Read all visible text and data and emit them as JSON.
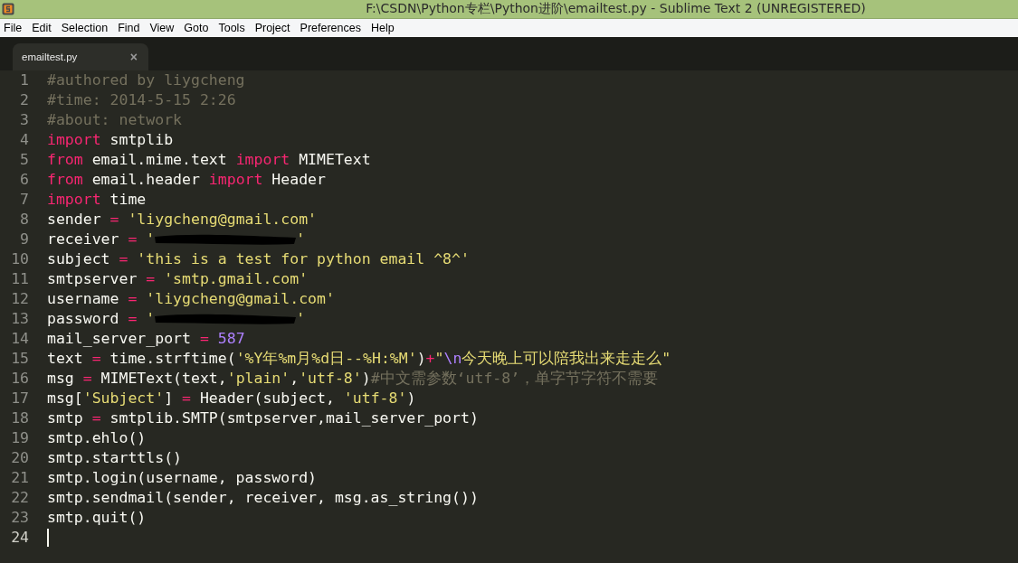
{
  "window": {
    "title": "F:\\CSDN\\Python专栏\\Python进阶\\emailtest.py - Sublime Text 2 (UNREGISTERED)"
  },
  "menu": [
    "File",
    "Edit",
    "Selection",
    "Find",
    "View",
    "Goto",
    "Tools",
    "Project",
    "Preferences",
    "Help"
  ],
  "tabs": [
    {
      "label": "emailtest.py",
      "selected": true,
      "close": "×"
    }
  ],
  "editor": {
    "lines": [
      {
        "number": "1",
        "current": false,
        "tokens": [
          {
            "kind": "comment",
            "text": "#authored by liygcheng"
          }
        ]
      },
      {
        "number": "2",
        "current": false,
        "tokens": [
          {
            "kind": "comment",
            "text": "#time: 2014-5-15 2:26"
          }
        ]
      },
      {
        "number": "3",
        "current": false,
        "tokens": [
          {
            "kind": "comment",
            "text": "#about: network"
          }
        ]
      },
      {
        "number": "4",
        "current": false,
        "tokens": [
          {
            "kind": "keyword",
            "text": "import"
          },
          {
            "kind": "plain",
            "text": " smtplib"
          }
        ]
      },
      {
        "number": "5",
        "current": false,
        "tokens": [
          {
            "kind": "keyword",
            "text": "from"
          },
          {
            "kind": "plain",
            "text": " email.mime.text "
          },
          {
            "kind": "keyword",
            "text": "import"
          },
          {
            "kind": "plain",
            "text": " MIMEText"
          }
        ]
      },
      {
        "number": "6",
        "current": false,
        "tokens": [
          {
            "kind": "keyword",
            "text": "from"
          },
          {
            "kind": "plain",
            "text": " email.header "
          },
          {
            "kind": "keyword",
            "text": "import"
          },
          {
            "kind": "plain",
            "text": " Header"
          }
        ]
      },
      {
        "number": "7",
        "current": false,
        "tokens": [
          {
            "kind": "keyword",
            "text": "import"
          },
          {
            "kind": "plain",
            "text": " time"
          }
        ]
      },
      {
        "number": "8",
        "current": false,
        "tokens": [
          {
            "kind": "plain",
            "text": "sender"
          },
          {
            "kind": "keyword",
            "text": " = "
          },
          {
            "kind": "string",
            "text": "'liygcheng@gmail.com'"
          }
        ]
      },
      {
        "number": "9",
        "current": false,
        "tokens": [
          {
            "kind": "plain",
            "text": "receiver"
          },
          {
            "kind": "keyword",
            "text": " = "
          },
          {
            "kind": "string",
            "text": "'"
          },
          {
            "kind": "redaction"
          },
          {
            "kind": "string",
            "text": "'"
          }
        ]
      },
      {
        "number": "10",
        "current": false,
        "tokens": [
          {
            "kind": "plain",
            "text": "subject"
          },
          {
            "kind": "keyword",
            "text": " = "
          },
          {
            "kind": "string",
            "text": "'this is a test for python email ^8^'"
          }
        ]
      },
      {
        "number": "11",
        "current": false,
        "tokens": [
          {
            "kind": "plain",
            "text": "smtpserver"
          },
          {
            "kind": "keyword",
            "text": " = "
          },
          {
            "kind": "string",
            "text": "'smtp.gmail.com'"
          }
        ]
      },
      {
        "number": "12",
        "current": false,
        "tokens": [
          {
            "kind": "plain",
            "text": "username"
          },
          {
            "kind": "keyword",
            "text": " = "
          },
          {
            "kind": "string",
            "text": "'liygcheng@gmail.com'"
          }
        ]
      },
      {
        "number": "13",
        "current": false,
        "tokens": [
          {
            "kind": "plain",
            "text": "password"
          },
          {
            "kind": "keyword",
            "text": " = "
          },
          {
            "kind": "string",
            "text": "'"
          },
          {
            "kind": "redaction"
          },
          {
            "kind": "string",
            "text": "'"
          }
        ]
      },
      {
        "number": "14",
        "current": false,
        "tokens": [
          {
            "kind": "plain",
            "text": "mail_server_port"
          },
          {
            "kind": "keyword",
            "text": " = "
          },
          {
            "kind": "number",
            "text": "587"
          }
        ]
      },
      {
        "number": "15",
        "current": false,
        "tokens": [
          {
            "kind": "plain",
            "text": "text "
          },
          {
            "kind": "keyword",
            "text": "="
          },
          {
            "kind": "plain",
            "text": " time.strftime("
          },
          {
            "kind": "string",
            "text": "'%Y年%m月%d日--%H:%M'"
          },
          {
            "kind": "plain",
            "text": ")"
          },
          {
            "kind": "keyword",
            "text": "+"
          },
          {
            "kind": "string",
            "text": "\""
          },
          {
            "kind": "number",
            "text": "\\n"
          },
          {
            "kind": "string",
            "text": "今天晚上可以陪我出来走走么\""
          }
        ]
      },
      {
        "number": "16",
        "current": false,
        "tokens": [
          {
            "kind": "plain",
            "text": "msg "
          },
          {
            "kind": "keyword",
            "text": "="
          },
          {
            "kind": "plain",
            "text": " MIMEText(text,"
          },
          {
            "kind": "string",
            "text": "'plain'"
          },
          {
            "kind": "plain",
            "text": ","
          },
          {
            "kind": "string",
            "text": "'utf-8'"
          },
          {
            "kind": "plain",
            "text": ")"
          },
          {
            "kind": "comment",
            "text": "#中文需参数‘utf-8’，单字节字符不需要"
          }
        ]
      },
      {
        "number": "17",
        "current": false,
        "tokens": [
          {
            "kind": "plain",
            "text": "msg["
          },
          {
            "kind": "string",
            "text": "'Subject'"
          },
          {
            "kind": "plain",
            "text": "] "
          },
          {
            "kind": "keyword",
            "text": "="
          },
          {
            "kind": "plain",
            "text": " Header(subject, "
          },
          {
            "kind": "string",
            "text": "'utf-8'"
          },
          {
            "kind": "plain",
            "text": ")"
          }
        ]
      },
      {
        "number": "18",
        "current": false,
        "tokens": [
          {
            "kind": "plain",
            "text": "smtp "
          },
          {
            "kind": "keyword",
            "text": "="
          },
          {
            "kind": "plain",
            "text": " smtplib.SMTP(smtpserver,mail_server_port)"
          }
        ]
      },
      {
        "number": "19",
        "current": false,
        "tokens": [
          {
            "kind": "plain",
            "text": "smtp.ehlo()"
          }
        ]
      },
      {
        "number": "20",
        "current": false,
        "tokens": [
          {
            "kind": "plain",
            "text": "smtp.starttls()"
          }
        ]
      },
      {
        "number": "21",
        "current": false,
        "tokens": [
          {
            "kind": "plain",
            "text": "smtp.login(username, password)"
          }
        ]
      },
      {
        "number": "22",
        "current": false,
        "tokens": [
          {
            "kind": "plain",
            "text": "smtp.sendmail(sender, receiver, msg.as_string())"
          }
        ]
      },
      {
        "number": "23",
        "current": false,
        "tokens": [
          {
            "kind": "plain",
            "text": "smtp.quit()"
          }
        ]
      },
      {
        "number": "24",
        "current": true
      }
    ]
  }
}
